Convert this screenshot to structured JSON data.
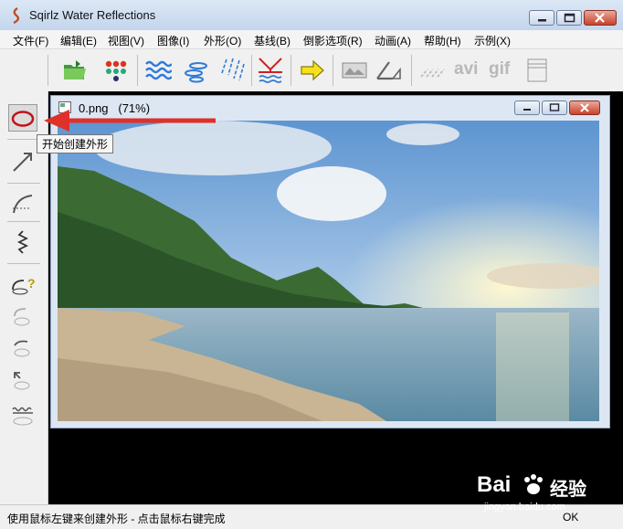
{
  "window": {
    "title": "Sqirlz Water Reflections",
    "minimize_icon": "minimize-icon",
    "maximize_icon": "maximize-icon",
    "close_icon": "close-icon"
  },
  "menu": [
    "文件(F)",
    "编辑(E)",
    "视图(V)",
    "图像(I)",
    "外形(O)",
    "基线(B)",
    "倒影选项(R)",
    "动画(A)",
    "帮助(H)",
    "示例(X)"
  ],
  "toolbar": {
    "icons": [
      "open-folder-icon",
      "color-dots-icon",
      "ripple-waves-icon",
      "ripple-ellipses-icon",
      "rain-streaks-icon",
      "reflection-baseline-icon",
      "arrow-right-icon",
      "preview-image-icon",
      "perspective-icon",
      "wave-lines-icon",
      "avi-export-icon",
      "gif-export-icon",
      "panel-icon"
    ],
    "avi_label": "avi",
    "gif_label": "gif"
  },
  "left_tools": [
    "ellipse-shape-icon",
    "arrow-tool-icon",
    "curve-tool-icon",
    "zigzag-tool-icon",
    "shape-help-icon",
    "shape-tool-icon",
    "shape-tool-icon",
    "shape-tool-icon",
    "wave-tool-icon"
  ],
  "child_window": {
    "title": "0.png   (71%)"
  },
  "tooltip": "开始创建外形",
  "status": {
    "text": "使用鼠标左键来创建外形 - 点击鼠标右键完成",
    "right": "OK"
  },
  "watermark": {
    "brand_left": "Bai",
    "brand_right": "经验",
    "url": "jingyan.baidu.com"
  },
  "colors": {
    "arrow": "#e0302a",
    "ellipse": "#c0141a",
    "toolbar_blue": "#2f7ad8"
  }
}
